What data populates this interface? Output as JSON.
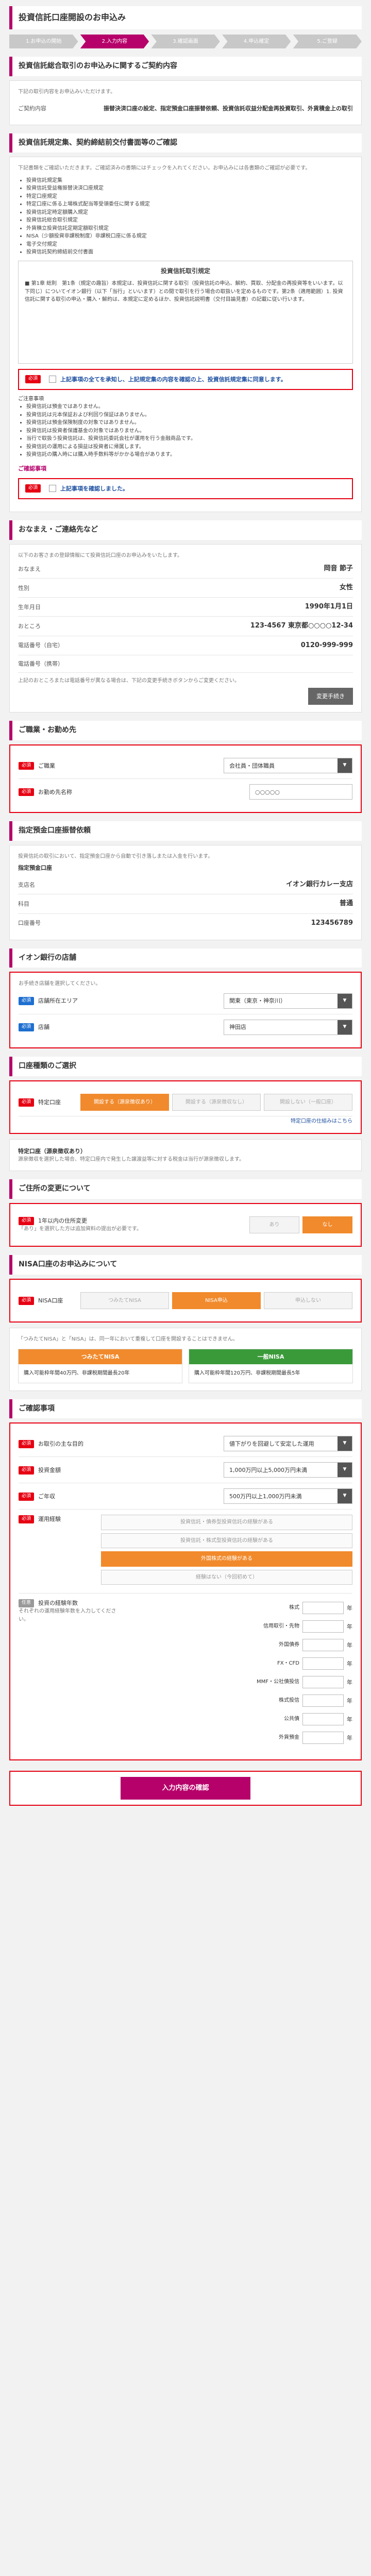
{
  "page_title": "投資信託口座開設のお申込み",
  "steps": [
    "1.お申込の開始",
    "2.入力内容",
    "3.確認画面",
    "4.申込確定",
    "5.ご登録"
  ],
  "consent": {
    "head": "投資信託総合取引のお申込みに関するご契約内容",
    "note": "下記の取引内容をお申込みいただけます。",
    "row_label": "ご契約内容",
    "row_value": "振替決済口座の設定、指定預金口座振替依頼、投資信託収益分配金再投資取引、外貨積金上の取引"
  },
  "rules": {
    "head": "投資信託規定集、契約締結前交付書面等のご確認",
    "intro": "下記書類をご確認いただきます。ご確認済みの書類にはチェックを入れてください。お申込みには各書類のご確認が必要です。",
    "docs": [
      "投資信託規定集",
      "投資信託受益権振替決済口座規定",
      "特定口座規定",
      "特定口座に係る上場株式配当等受領委任に関する規定",
      "投資信託定時定額購入規定",
      "投資信託総合取引規定",
      "外貨積立投資信託定期定額取引規定",
      "NISA（少額投資非課税制度）非課税口座に係る規定",
      "電子交付規定",
      "投資信託契約締結前交付書面"
    ],
    "box_title": "投資信託取引規定",
    "box_text": "■ 第1章 総則　第1条（規定の趣旨）本規定は、投資信託に関する取引（投資信託の申込、解約、買取、分配金の再投資等をいいます。以下同じ）についてイオン銀行（以下「当行」といいます）との間で取引を行う場合の取扱いを定めるものです。第2条（適用範囲）1. 投資信託に関する取引の申込・購入・解約は、本規定に定めるほか、投資信託説明書（交付目論見書）の記載に従い行います。",
    "check1": "上記事項の全てを承知し、上記規定集の内容を確認の上、投資信託規定集に同意します。",
    "notice_head": "ご注意事項",
    "notices": [
      "投資信託は預金ではありません。",
      "投資信託は元本保証および利回り保証はありません。",
      "投資信託は預金保険制度の対象ではありません。",
      "投資信託は投資者保護基金の対象ではありません。",
      "当行で取扱う投資信託は、投資信託委託会社が運用を行う金融商品です。",
      "投資信託の運用による損益は投資者に帰属します。",
      "投資信託の購入時には購入時手数料等がかかる場合があります。"
    ],
    "check2_head": "ご確認事項",
    "check2": "上記事項を確認しました。"
  },
  "customer": {
    "head": "おなまえ・ご連絡先など",
    "note": "以下のお客さまの登録情報にて投資信託口座のお申込みをいたします。",
    "rows": [
      {
        "label": "おなまえ",
        "value": "岡音 節子"
      },
      {
        "label": "性別",
        "value": "女性"
      },
      {
        "label": "生年月日",
        "value": "1990年1月1日"
      },
      {
        "label": "おところ",
        "value": "123-4567 東京都○○○○12-34"
      },
      {
        "label": "電話番号（自宅）",
        "value": "0120-999-999"
      },
      {
        "label": "電話番号（携帯）",
        "value": ""
      }
    ],
    "change_note": "上記のおところまたは電話番号が異なる場合は、下記の変更手続きボタンからご変更ください。",
    "change_btn": "変更手続き"
  },
  "job": {
    "head": "ご職業・お勤め先",
    "job_label": "ご職業",
    "job_value": "会社員・団体職員",
    "company_label": "お勤め先名称",
    "company_value": "○○○○○"
  },
  "account": {
    "head": "指定預金口座振替依頼",
    "note": "投資信託の取引において、指定預金口座から自動で引き落しまたは入金を行います。",
    "sub": "指定預金口座",
    "rows": [
      {
        "label": "支店名",
        "value": "イオン銀行カレー支店"
      },
      {
        "label": "科目",
        "value": "普通"
      },
      {
        "label": "口座番号",
        "value": "123456789"
      }
    ]
  },
  "branch": {
    "head": "イオン銀行の店舗",
    "note": "お手続き店舗を選択してください。",
    "area_label": "店舗所在エリア",
    "area_value": "関東（東京・神奈川）",
    "store_label": "店舗",
    "store_value": "神田店"
  },
  "type": {
    "head": "口座種類のご選択",
    "label": "特定口座",
    "options": [
      "開設する（源泉徴収あり）",
      "開設する（源泉徴収なし）",
      "開設しない（一般口座）"
    ],
    "link": "特定口座の仕組みはこちら",
    "sub_head": "特定口座（源泉徴収あり）",
    "sub_note": "源泉徴収を選択した場合、特定口座内で発生した譲渡益等に対する税金は当行が源泉徴収します。"
  },
  "address": {
    "head": "ご住所の変更について",
    "label": "1年以内の住所変更",
    "note": "「あり」を選択した方は追加資料の提出が必要です。",
    "options": [
      "あり",
      "なし"
    ]
  },
  "nisa": {
    "head": "NISA口座のお申込みについて",
    "label": "NISA口座",
    "options": [
      "つみたてNISA",
      "NISA申込",
      "申込しない"
    ],
    "note": "「つみたてNISA」と「NISA」は、同一年において重複して口座を開設することはできません。",
    "col1_head": "つみたてNISA",
    "col1_body": "購入可能枠年間40万円、非課税期間最長20年",
    "col2_head": "一般NISA",
    "col2_body": "購入可能枠年間120万円、非課税期間最長5年"
  },
  "confirm": {
    "head": "ご確認事項",
    "q1_label": "お取引の主な目的",
    "q1_value": "値下がりを回避して安定した運用",
    "q2_label": "投資金額",
    "q2_value": "1,000万円以上5,000万円未満",
    "q3_label": "ご年収",
    "q3_value": "500万円以上1,000万円未満",
    "q4_label": "運用経験",
    "q4_options": [
      "投資信託・債券型投資信託の経験がある",
      "投資信託・株式型投資信託の経験がある",
      "外国株式の経験がある",
      "経験はない（今回初めて）"
    ],
    "q5_label": "投資の経験年数",
    "q5_note": "それぞれの運用経験年数を入力してください。",
    "amounts": [
      "株式",
      "信用取引・先物",
      "外国債券",
      "FX・CFD",
      "MMF・公社債投信",
      "株式投信",
      "公共債",
      "外貨預金"
    ],
    "unit": "年"
  },
  "submit": "入力内容の確認"
}
